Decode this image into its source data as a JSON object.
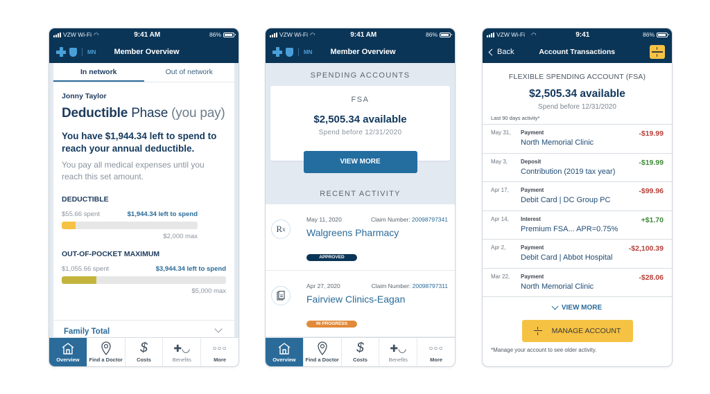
{
  "status_bar": {
    "carrier": "VZW Wi-Fi",
    "time_full": "9:41 AM",
    "time_short": "9:41",
    "battery": "86%"
  },
  "brand": {
    "region": "MN",
    "primary_color": "#0b3557",
    "accent_color": "#2a6b99",
    "highlight_color": "#f6c244"
  },
  "screen1": {
    "nav_title": "Member Overview",
    "tabs": [
      {
        "label": "In network",
        "active": true
      },
      {
        "label": "Out of network",
        "active": false
      }
    ],
    "member_name": "Jonny Taylor",
    "phase_bold": "Deductible",
    "phase_word": " Phase ",
    "phase_suffix": "(you pay)",
    "headline": "You have $1,944.34 left to spend to reach your annual deductible.",
    "subtext": "You pay all medical expenses until you reach this set amount.",
    "deductible": {
      "label": "DEDUCTIBLE",
      "spent": "$55.66 spent",
      "left": "$1,944.34 left to spend",
      "max": "$2,000 max",
      "progress_percent": 2.8,
      "color": "#f6c244"
    },
    "oop": {
      "label": "OUT-OF-POCKET MAXIMUM",
      "spent": "$1,055.66 spent",
      "left": "$3,944.34 left to spend",
      "max": "$5,000 max",
      "progress_percent": 21.1,
      "color": "#c3b53c"
    },
    "family_total": "Family Total"
  },
  "screen2": {
    "nav_title": "Member Overview",
    "spending_header": "SPENDING ACCOUNTS",
    "fsa": {
      "title": "FSA",
      "amount": "$2,505.34 available",
      "deadline": "Spend before 12/31/2020",
      "button": "VIEW MORE"
    },
    "activity_header": "RECENT ACTIVITY",
    "activities": [
      {
        "icon": "rx-icon",
        "icon_text": "Rx",
        "date": "May 11, 2020",
        "claim_label": "Claim Number: ",
        "claim_number": "20098797341",
        "provider": "Walgreens Pharmacy",
        "status": "APPROVED",
        "status_color": "#0b3557"
      },
      {
        "icon": "document-icon",
        "icon_text": "",
        "date": "Apr 27, 2020",
        "claim_label": "Claim Number: ",
        "claim_number": "20098797311",
        "provider": "Fairview Clinics-Eagan",
        "status": "IN PROGRESS",
        "status_color": "#e08a3a"
      }
    ]
  },
  "screen3": {
    "back_label": "Back",
    "nav_title": "Account Transactions",
    "account_title": "FLEXIBLE SPENDING ACCOUNT (FSA)",
    "amount": "$2,505.34 available",
    "deadline": "Spend before 12/31/2020",
    "activity_note": "Last 90 days activity*",
    "transactions": [
      {
        "date": "May 31,",
        "type": "Payment",
        "description": "North Memorial Clinic",
        "amount": "-$19.99",
        "color": "#b5413a"
      },
      {
        "date": "May 3,",
        "type": "Deposit",
        "description": "Contribution (2019 tax year)",
        "amount": "-$19.99",
        "color": "#3f8a3a"
      },
      {
        "date": "Apr 17,",
        "type": "Payment",
        "description": "Debit Card | DC Group PC",
        "amount": "-$99.96",
        "color": "#b5413a"
      },
      {
        "date": "Apr 14,",
        "type": "Interest",
        "description": "Premium FSA... APR=0.75%",
        "amount": "+$1.70",
        "color": "#3f8a3a"
      },
      {
        "date": "Apr 2,",
        "type": "Payment",
        "description": "Debit Card | Abbot Hospital",
        "amount": "-$2,100.39",
        "color": "#b5413a"
      },
      {
        "date": "Mar 22,",
        "type": "Payment",
        "description": "North Memorial Clinic",
        "amount": "-$28.06",
        "color": "#b5413a"
      }
    ],
    "view_more": "VIEW MORE",
    "manage_button": "MANAGE ACCOUNT",
    "footnote": "*Manage your account to see older activity."
  },
  "bottom_nav": [
    {
      "label": "Overview",
      "icon": "home-icon",
      "active": true
    },
    {
      "label": "Find a Doctor",
      "icon": "location-pin-icon",
      "active": false
    },
    {
      "label": "Costs",
      "icon": "dollar-icon",
      "active": false
    },
    {
      "label": "Benefits",
      "icon": "benefits-icon",
      "active": false
    },
    {
      "label": "More",
      "icon": "more-icon",
      "active": false
    }
  ]
}
